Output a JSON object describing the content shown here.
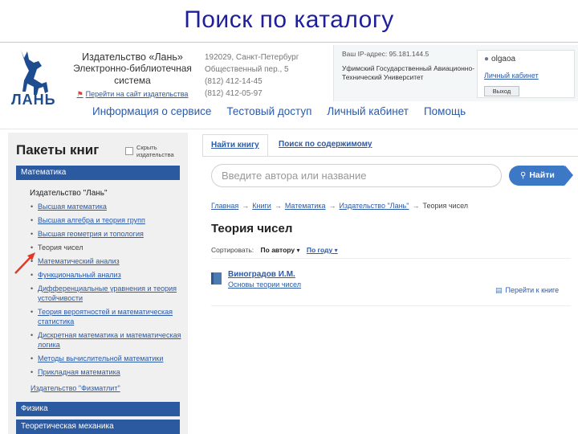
{
  "slide_title": "Поиск по каталогу",
  "header": {
    "logo_text": "ЛАНЬ",
    "publisher_name": "Издательство «Лань»",
    "publisher_sub": [
      "Электронно-библиотечная",
      "система"
    ],
    "site_link": "Перейти на сайт издательства",
    "address_lines": [
      "192029, Санкт-Петербург",
      "Общественный пер., 5",
      "(812) 412-14-45",
      "(812) 412-05-97"
    ],
    "org_ip": "Ваш IP-адрес: 95.181.144.5",
    "org_name": "Уфимский Государственный Авиационно-Технический Университет",
    "user_name": "olgaoa",
    "user_cabinet": "Личный кабинет",
    "logout_label": "Выход"
  },
  "nav": [
    "Информация о сервисе",
    "Тестовый доступ",
    "Личный кабинет",
    "Помощь"
  ],
  "sidebar": {
    "title": "Пакеты книг",
    "hide_label": "Скрыть издательства",
    "category_active": "Математика",
    "publisher_group": "Издательство \"Лань\"",
    "subcategories": [
      {
        "label": "Высшая математика",
        "active": false
      },
      {
        "label": "Высшая алгебра и теория групп",
        "active": false
      },
      {
        "label": "Высшая геометрия и топология",
        "active": false
      },
      {
        "label": "Теория чисел",
        "active": true
      },
      {
        "label": "Математический анализ",
        "active": false
      },
      {
        "label": "Функциональный анализ",
        "active": false
      },
      {
        "label": "Дифференциальные уравнения и теория устойчивости",
        "active": false
      },
      {
        "label": "Теория вероятностей и математическая статистика",
        "active": false
      },
      {
        "label": "Дискретная математика и математическая логика",
        "active": false
      },
      {
        "label": "Методы вычислительной математики",
        "active": false
      },
      {
        "label": "Прикладная математика",
        "active": false
      }
    ],
    "fizmat": "Издательство \"Физматлит\"",
    "category_2": "Физика",
    "category_3": "Теоретическая механика"
  },
  "content": {
    "tab_1": "Найти книгу",
    "tab_2": "Поиск по содержимому",
    "search_placeholder": "Введите автора или название",
    "search_button": "Найти",
    "breadcrumb": [
      "Главная",
      "Книги",
      "Математика",
      "Издательство \"Лань\"",
      "Теория чисел"
    ],
    "page_title": "Теория чисел",
    "sort_label": "Сортировать:",
    "sort_by_author": "По автору",
    "sort_by_year": "По году",
    "book_author": "Виноградов И.М.",
    "book_title": "Основы теории чисел",
    "goto_book": "Перейти к книге"
  },
  "colors": {
    "title_blue": "#1f1f9e",
    "category_bar": "#2c5aa0",
    "link_blue": "#2b5aa8",
    "search_button": "#3d78c6",
    "arrow_red": "#e03a2a"
  }
}
